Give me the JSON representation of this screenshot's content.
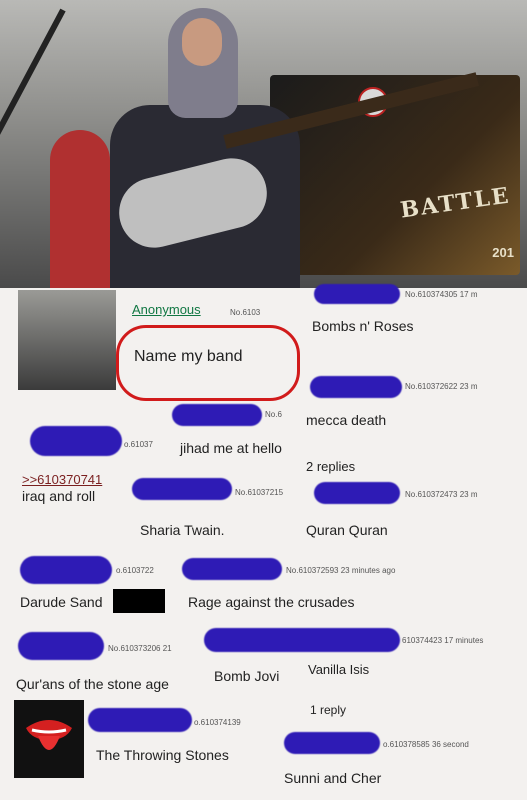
{
  "posts": {
    "op_name": "Anonymous",
    "op_no": "No.6103",
    "op_text": "Name my band",
    "p1_meta": "No.610374305 17 m",
    "p1_text": "Bombs n' Roses",
    "p2_meta": "No.610372622 23 m",
    "p3_meta": "No.6",
    "p3_text": "mecca death",
    "p4_meta": "o.61037",
    "p4_text": "jihad me at hello",
    "p5_replies": "2 replies",
    "p6_quote": ">>610370741",
    "p6_text": "iraq and roll",
    "p6_meta": "No.61037215",
    "p7_meta": "No.610372473 23 m",
    "p8_text": "Sharia Twain.",
    "p9_text": "Quran Quran",
    "p10_meta": "o.6103722",
    "p11_meta": "No.610372593 23 minutes ago",
    "p12_text": "Darude Sand",
    "p13_text": "Rage against the crusades",
    "p14_meta": "No.610373206 21",
    "p15_meta": "610374423 17 minutes",
    "p16_text": "Qur'ans of the stone age",
    "p17_text": "Bomb Jovi",
    "p18_text": "Vanilla Isis",
    "p19_replies": "1 reply",
    "p20_meta": "o.610374139",
    "p21_text": "The Throwing Stones",
    "p22_meta": "o.610378585 36 second",
    "p23_text": "Sunni and Cher"
  },
  "photo": {
    "banner_title": "BATTLE",
    "banner_year": "201"
  },
  "colors": {
    "redaction": "#2e1bb5",
    "highlight_oval": "#d11b1b"
  }
}
